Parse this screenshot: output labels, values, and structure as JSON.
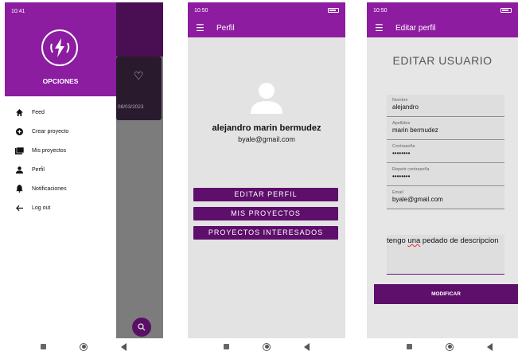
{
  "screen1": {
    "status_time": "10:41",
    "drawer_title": "OPCIONES",
    "menu": [
      {
        "icon": "home-icon",
        "label": "Feed"
      },
      {
        "icon": "add-circle-icon",
        "label": "Crear proyecto"
      },
      {
        "icon": "folders-icon",
        "label": "Mis proyectos"
      },
      {
        "icon": "person-icon",
        "label": "Perfil"
      },
      {
        "icon": "bell-icon",
        "label": "Notificaciones"
      },
      {
        "icon": "arrow-left-icon",
        "label": "Log out"
      }
    ],
    "background_date": "08/03/2023"
  },
  "screen2": {
    "status_time": "10:50",
    "appbar_title": "Perfil",
    "user_name": "alejandro marin bermudez",
    "user_email": "byale@gmail.com",
    "buttons": [
      "EDITAR PERFIL",
      "MIS PROYECTOS",
      "PROYECTOS INTERESADOS"
    ]
  },
  "screen3": {
    "status_time": "10:50",
    "appbar_title": "Editar perfil",
    "heading": "EDITAR USUARIO",
    "fields": [
      {
        "label": "Nombre",
        "value": "alejandro"
      },
      {
        "label": "Apellidos",
        "value": "marin bermudez"
      },
      {
        "label": "Contraseña",
        "value": "••••••••"
      },
      {
        "label": "Repetir contraseña",
        "value": "••••••••"
      },
      {
        "label": "Email",
        "value": "byale@gmail.com"
      }
    ],
    "description_pre": "tengo ",
    "description_misspelled": "una",
    "description_post": " pedado de descripcion",
    "submit_label": "MODIFICAR"
  },
  "colors": {
    "primary": "#8d1ca0",
    "button": "#5e0e6b",
    "background": "#e3e3e3"
  }
}
